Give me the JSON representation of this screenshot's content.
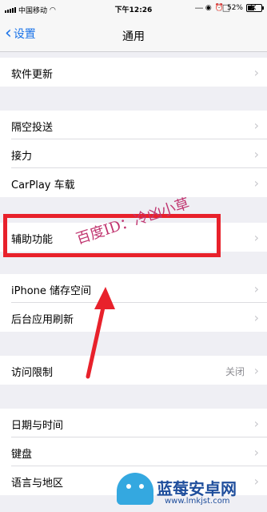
{
  "status_bar": {
    "carrier": "中国移动",
    "time": "下午12:26",
    "battery": "52%"
  },
  "nav": {
    "back_label": "设置",
    "title": "通用"
  },
  "rows": [
    {
      "label": "软件更新"
    },
    {
      "label": "隔空投送"
    },
    {
      "label": "接力"
    },
    {
      "label": "CarPlay 车载"
    },
    {
      "label": "辅助功能"
    },
    {
      "label": "iPhone 储存空间"
    },
    {
      "label": "后台应用刷新"
    },
    {
      "label": "访问限制",
      "value": "关闭"
    },
    {
      "label": "日期与时间"
    },
    {
      "label": "键盘"
    },
    {
      "label": "语言与地区"
    }
  ],
  "annotation": {
    "text": "百度ID：冷凶小草"
  },
  "watermark_logo": {
    "brand": "蓝莓安卓网",
    "url": "www.lmkjst.com"
  },
  "colors": {
    "accent": "#1a73e8",
    "highlight": "#e8212b",
    "background": "#efeff4"
  }
}
